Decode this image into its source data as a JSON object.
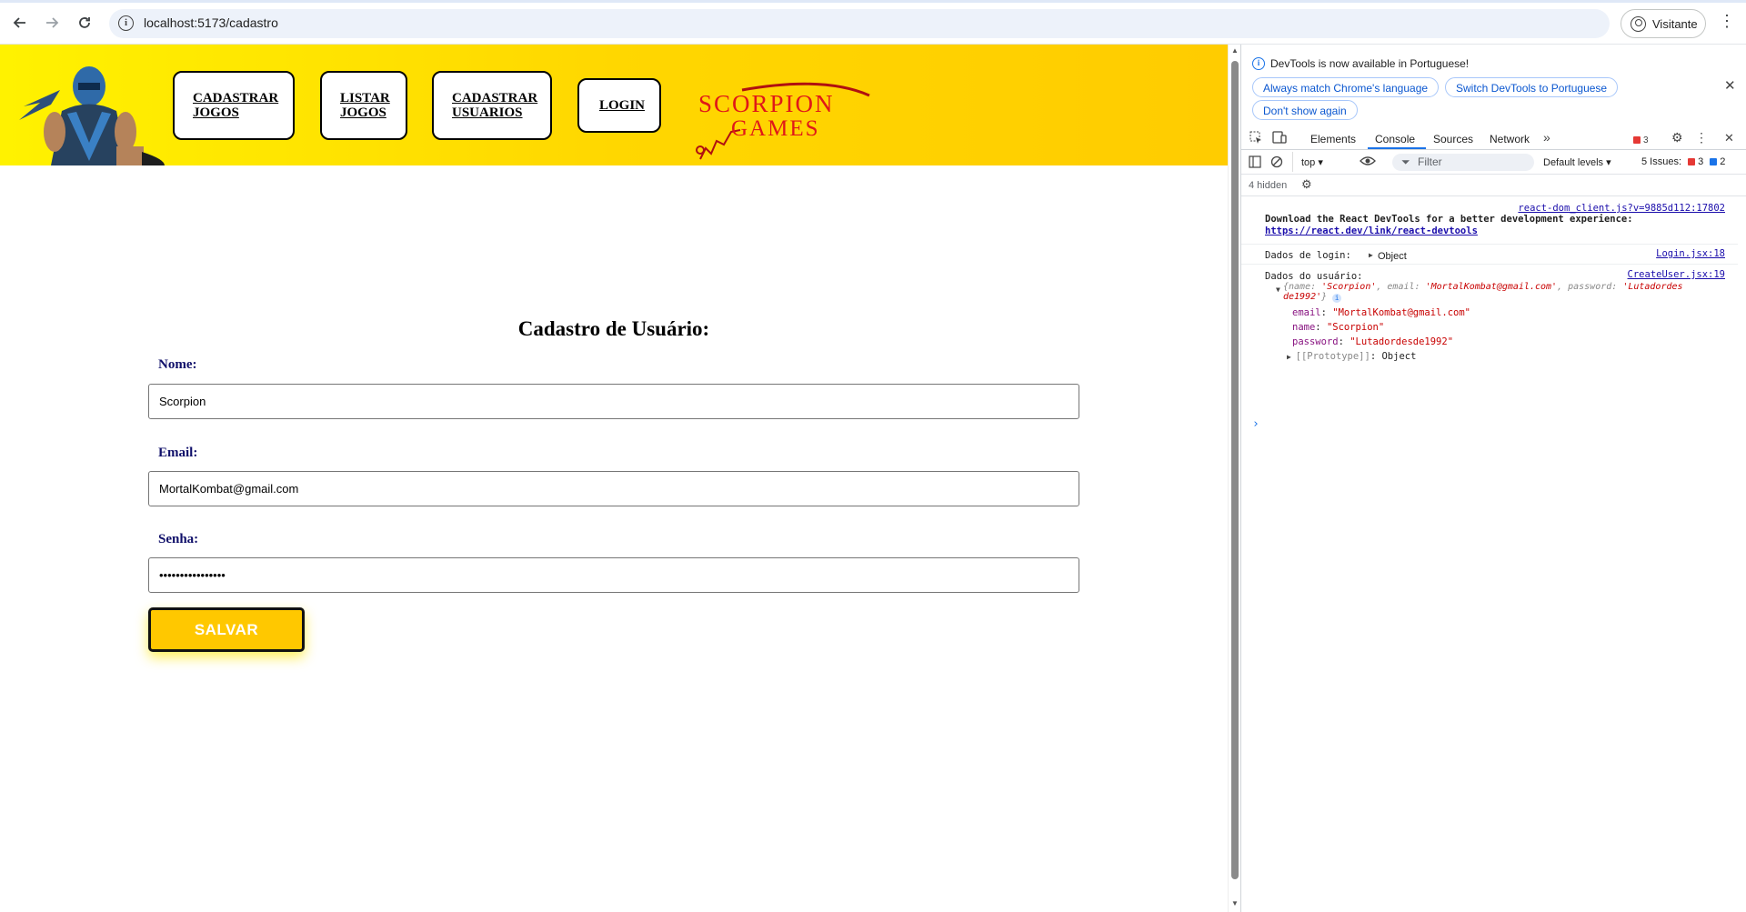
{
  "browser": {
    "url": "localhost:5173/cadastro",
    "profile_label": "Visitante"
  },
  "site": {
    "nav": [
      {
        "line1": "CADASTRAR",
        "line2": "JOGOS"
      },
      {
        "line1": "LISTAR",
        "line2": "JOGOS"
      },
      {
        "line1": "CADASTRAR",
        "line2": "USUARIOS"
      },
      {
        "line1": "LOGIN",
        "line2": ""
      }
    ],
    "logo_text": "SCORPION GAMES",
    "colors": {
      "header_start": "#fff200",
      "header_end": "#ffcc00",
      "button": "#ffc800",
      "label": "#10106a"
    }
  },
  "form": {
    "title": "Cadastro de Usuário:",
    "name_label": "Nome:",
    "name_value": "Scorpion",
    "email_label": "Email:",
    "email_value": "MortalKombat@gmail.com",
    "password_label": "Senha:",
    "password_value": "Lutadordesde1992",
    "save_label": "SALVAR"
  },
  "devtools": {
    "banner_message": "DevTools is now available in Portuguese!",
    "banner_buttons": [
      "Always match Chrome's language",
      "Switch DevTools to Portuguese",
      "Don't show again"
    ],
    "tabs": [
      "Elements",
      "Console",
      "Sources",
      "Network"
    ],
    "active_tab": "Console",
    "error_count": "3",
    "context": "top",
    "filter_placeholder": "Filter",
    "levels": "Default levels",
    "issues_label": "5 Issues:",
    "issues_errors": "3",
    "issues_info": "2",
    "hidden_label": "4 hidden",
    "console": {
      "line1_source": "react-dom_client.js?v=9885d112:17802",
      "line1_text": "Download the React DevTools for a better development experience:",
      "line1_link": "https://react.dev/link/react-devtools",
      "line2_label": "Dados de login:",
      "line2_value": "Object",
      "line2_source": "Login.jsx:18",
      "line3_label": "Dados do usuário:",
      "line3_source": "CreateUser.jsx:19",
      "obj_preview_start": "{name: ",
      "obj_preview_name": "'Scorpion'",
      "obj_preview_email_key": ", email: ",
      "obj_preview_email": "'MortalKombat@gmail.com'",
      "obj_preview_pw_key": ", password: ",
      "obj_preview_pw1": "'Lutadordes",
      "obj_preview_pw2": "de1992'",
      "obj_preview_end": "}",
      "prop_email_key": "email",
      "prop_email_val": "\"MortalKombat@gmail.com\"",
      "prop_name_key": "name",
      "prop_name_val": "\"Scorpion\"",
      "prop_pw_key": "password",
      "prop_pw_val": "\"Lutadordesde1992\"",
      "proto_key": "[[Prototype]]",
      "proto_val": "Object"
    }
  }
}
